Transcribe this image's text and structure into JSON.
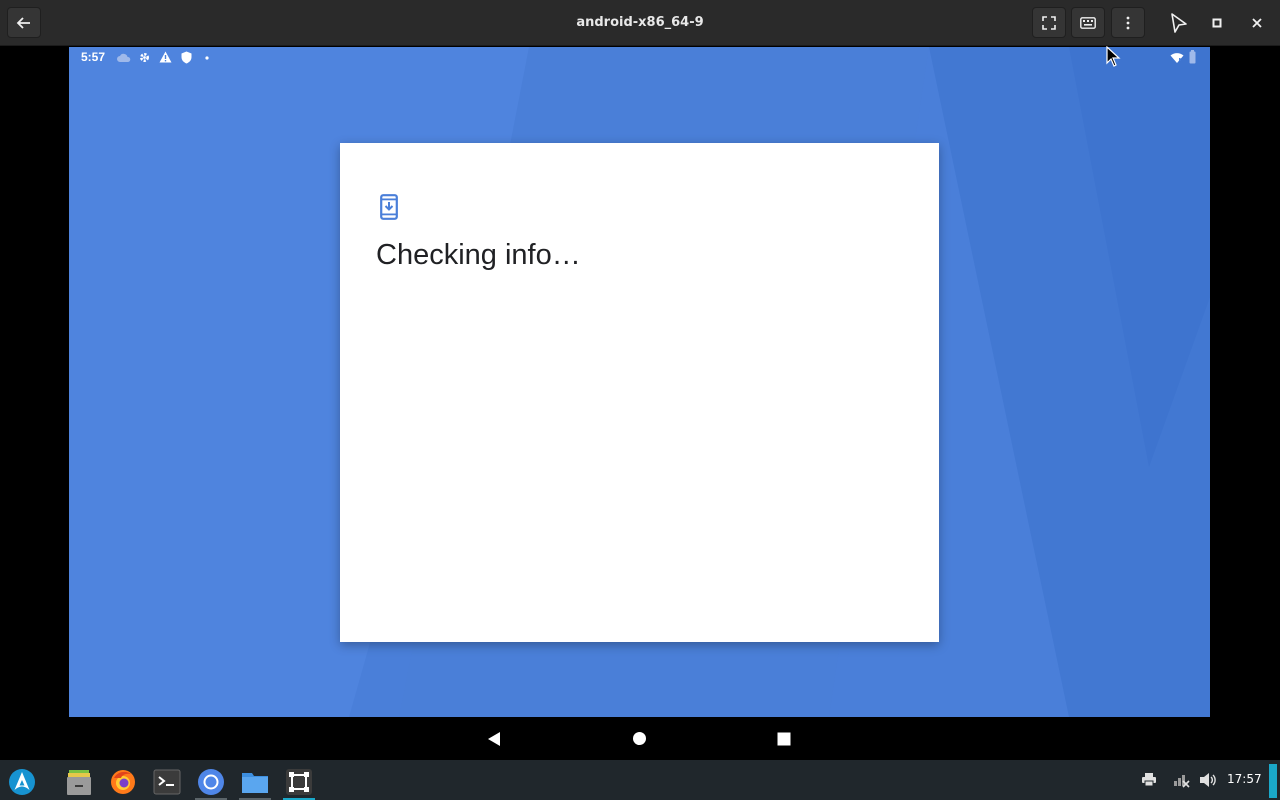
{
  "window": {
    "title": "android-x86_64-9"
  },
  "android": {
    "status_time": "5:57",
    "dialog_title": "Checking info…"
  },
  "taskbar": {
    "apps": [
      "launcher",
      "files-manager",
      "firefox",
      "terminal",
      "chromium",
      "folder",
      "screenshot-tool"
    ],
    "clock": "17:57"
  },
  "colors": {
    "accent": "#1aa8c9",
    "android_background": "#4a7fd9",
    "dialog_icon": "#4a7fd9"
  }
}
